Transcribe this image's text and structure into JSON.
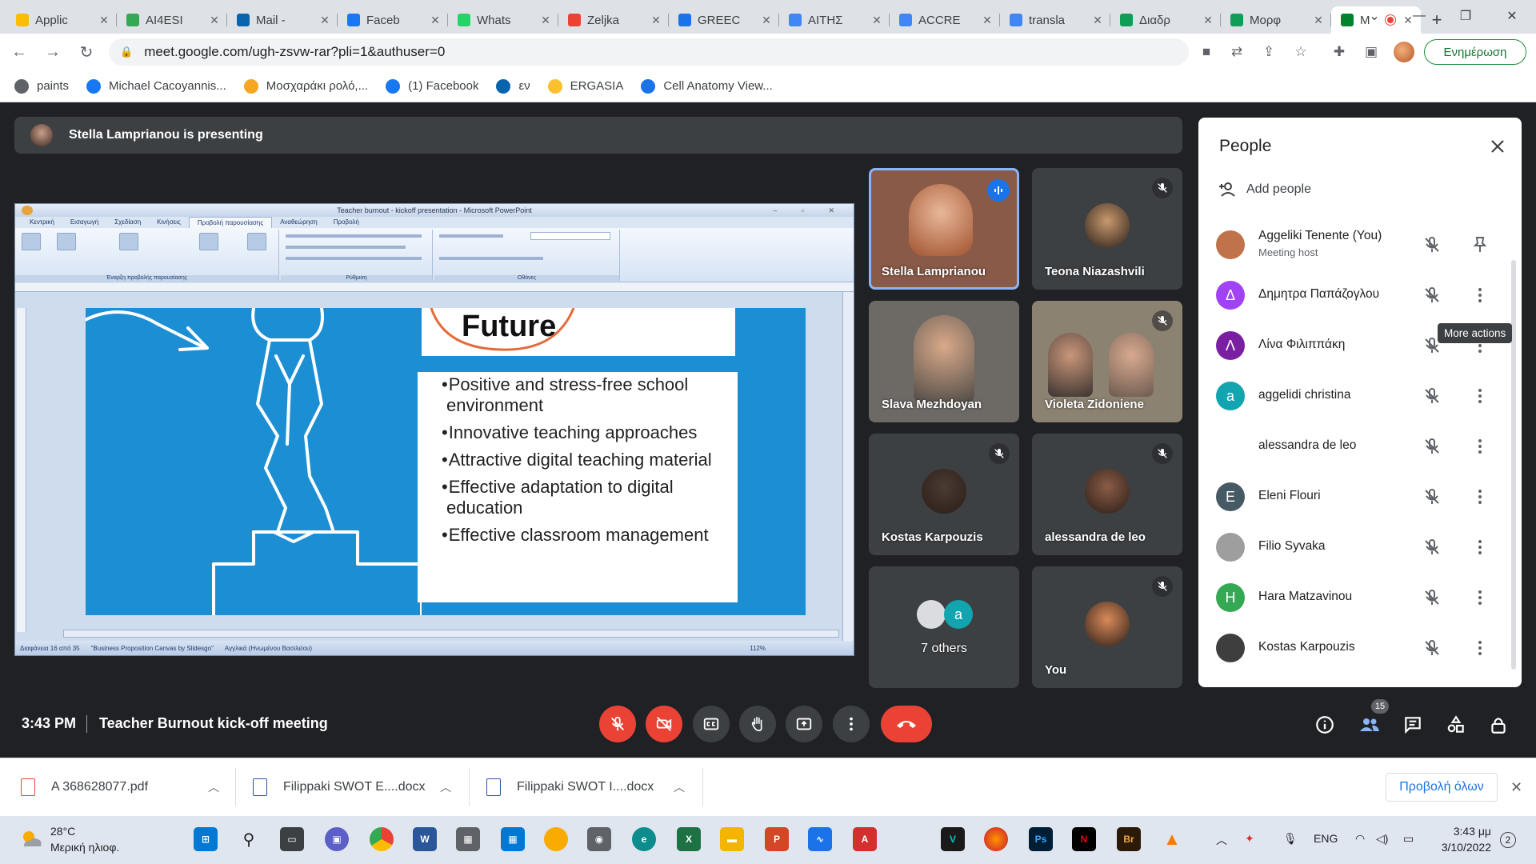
{
  "browser": {
    "tabs": [
      {
        "title": "Applic",
        "color": "#fbbc04"
      },
      {
        "title": "AI4ESI",
        "color": "#34a853"
      },
      {
        "title": "Mail -",
        "color": "#0a64ad"
      },
      {
        "title": "Faceb",
        "color": "#1877f2"
      },
      {
        "title": "Whats",
        "color": "#25d366"
      },
      {
        "title": "Zeljka",
        "color": "#ea4335"
      },
      {
        "title": "GREEC",
        "color": "#1a73e8"
      },
      {
        "title": "ΑΙΤΗΣ",
        "color": "#4285f4"
      },
      {
        "title": "ACCRE",
        "color": "#4285f4"
      },
      {
        "title": "transla",
        "color": "#4285f4"
      },
      {
        "title": "Διαδρ",
        "color": "#0f9d58"
      },
      {
        "title": "Μορφ",
        "color": "#0f9d58"
      },
      {
        "title": "M",
        "color": "#00832d",
        "active": true
      }
    ],
    "url": "meet.google.com/ugh-zsvw-rar?pli=1&authuser=0",
    "update_label": "Ενημέρωση",
    "bookmarks": [
      {
        "label": "paints",
        "color": "#5f6368"
      },
      {
        "label": "Michael Cacoyannis...",
        "color": "#1877f2"
      },
      {
        "label": "Μοσχαράκι ρολό,...",
        "color": "#f5a623"
      },
      {
        "label": "(1) Facebook",
        "color": "#1877f2"
      },
      {
        "label": "εν",
        "color": "#0a64ad"
      },
      {
        "label": "ERGASIA",
        "color": "#fbc02d"
      },
      {
        "label": "Cell Anatomy View...",
        "color": "#1a73e8"
      }
    ]
  },
  "meet": {
    "presenting_text": "Stella Lamprianou is presenting",
    "time": "3:43 PM",
    "meeting_name": "Teacher Burnout kick-off meeting",
    "people_count": "15",
    "tiles": [
      {
        "name": "Stella Lamprianou",
        "bg": "#8a5a48",
        "active": true,
        "talking": true
      },
      {
        "name": "Teona Niazashvili",
        "bg": "#3c4043",
        "avatar": "#c79a6e",
        "muted": true
      },
      {
        "name": "Slava Mezhdoyan",
        "bg": "#6d6a66"
      },
      {
        "name": "Violeta Zidoniene",
        "bg": "#8c8271",
        "muted": true
      },
      {
        "name": "Kostas Karpouzis",
        "bg": "#3c4043",
        "avatar": "#4a3b33",
        "muted": true
      },
      {
        "name": "alessandra de leo",
        "bg": "#3c4043",
        "avatar": "#8a5c46",
        "muted": true
      },
      {
        "name": "7 others",
        "bg": "#3c4043"
      },
      {
        "name": "You",
        "bg": "#3c4043",
        "avatar": "#d98a5a",
        "muted": true
      }
    ]
  },
  "presentation": {
    "window_title": "Teacher burnout - kickoff presentation - Microsoft PowerPoint",
    "ribbon_tabs": [
      "Κεντρική",
      "Εισαγωγή",
      "Σχεδίαση",
      "Κινήσεις",
      "Προβολή παρουσίασης",
      "Αναθεώρηση",
      "Προβολή"
    ],
    "ribbon_groups": [
      "Έναρξη προβολής παρουσίασης",
      "Ρύθμιση",
      "Οθόνες"
    ],
    "status": [
      "Διαφάνεια 16 από 35",
      "\"Business Proposition Canvas by Slidesgo\"",
      "Αγγλικά (Ηνωμένου Βασιλείου)"
    ],
    "zoom": "112%",
    "slide_title": "Future",
    "bullets": [
      "Positive and stress-free  school environment",
      "Innovative teaching approaches",
      "Attractive digital teaching material",
      "Effective adaptation to digital education",
      "Effective classroom management"
    ]
  },
  "people_panel": {
    "title": "People",
    "add_label": "Add people",
    "tooltip": "More actions",
    "people": [
      {
        "name": "Aggeliki Tenente (You)",
        "subtitle": "Meeting host",
        "avatar_color": "#c0734a",
        "initial": ""
      },
      {
        "name": "Δημητρα Παπάζογλου",
        "avatar_color": "#a142f4",
        "initial": "Δ"
      },
      {
        "name": "Λίνα Φιλιππάκη",
        "avatar_color": "#7b1fa2",
        "initial": "Λ"
      },
      {
        "name": "aggelidi christina",
        "avatar_color": "#12a4af",
        "initial": "a"
      },
      {
        "name": "alessandra de leo",
        "avatar_color": "#ffffff",
        "initial": ""
      },
      {
        "name": "Eleni Flouri",
        "avatar_color": "#455a64",
        "initial": "E"
      },
      {
        "name": "Filio Syvaka",
        "avatar_color": "#9e9e9e",
        "initial": ""
      },
      {
        "name": "Hara Matzavinou",
        "avatar_color": "#34a853",
        "initial": "H"
      },
      {
        "name": "Kostas Karpouzis",
        "avatar_color": "#3e3e3e",
        "initial": ""
      }
    ]
  },
  "downloads": {
    "items": [
      "A 368628077.pdf",
      "Filippaki SWOT E....docx",
      "Filippaki SWOT I....docx"
    ],
    "show_all": "Προβολή όλων"
  },
  "taskbar": {
    "temp": "28°C",
    "weather": "Μερική ηλιοφ.",
    "lang": "ENG",
    "clock_time": "3:43 μμ",
    "clock_date": "3/10/2022",
    "notif_count": "2"
  },
  "colors": {
    "meet_bg": "#202124",
    "tile_bg": "#3c4043",
    "danger": "#ea4335",
    "accent": "#1a73e8",
    "slide_blue": "#1c8fd4"
  }
}
